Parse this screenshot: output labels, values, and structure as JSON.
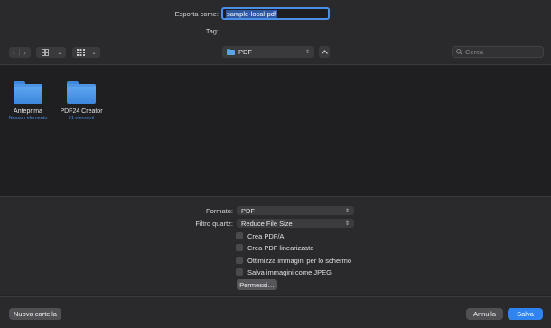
{
  "header": {
    "save_as_label": "Esporta come:",
    "save_as_value": "sample-local-pdf",
    "tags_label": "Tag:"
  },
  "toolbar": {
    "back_icon": "chevron-left-icon",
    "forward_icon": "chevron-right-icon",
    "view_icon": "icon-grid-icon",
    "group_icon": "group-list-icon",
    "location": "PDF",
    "search_placeholder": "Cerca"
  },
  "browser": {
    "items": [
      {
        "name": "Anteprima",
        "subtitle": "Nessun elemento"
      },
      {
        "name": "PDF24 Creator",
        "subtitle": "21 elementi"
      }
    ]
  },
  "options": {
    "format_label": "Formato:",
    "format_value": "PDF",
    "quartz_label": "Filtro quartz:",
    "quartz_value": "Reduce File Size",
    "checkboxes": [
      {
        "label": "Crea PDF/A",
        "checked": false
      },
      {
        "label": "Crea PDF linearizzato",
        "checked": false
      },
      {
        "label": "Ottimizza immagini per lo schermo",
        "checked": false
      },
      {
        "label": "Salva immagini come JPEG",
        "checked": false
      }
    ],
    "permissions_label": "Permessi…"
  },
  "footer": {
    "new_folder": "Nuova cartella",
    "cancel": "Annulla",
    "save": "Salva"
  },
  "colors": {
    "accent": "#2f84ef",
    "folder": "#4f95e6",
    "item_subtitle": "#4a8fe0"
  }
}
